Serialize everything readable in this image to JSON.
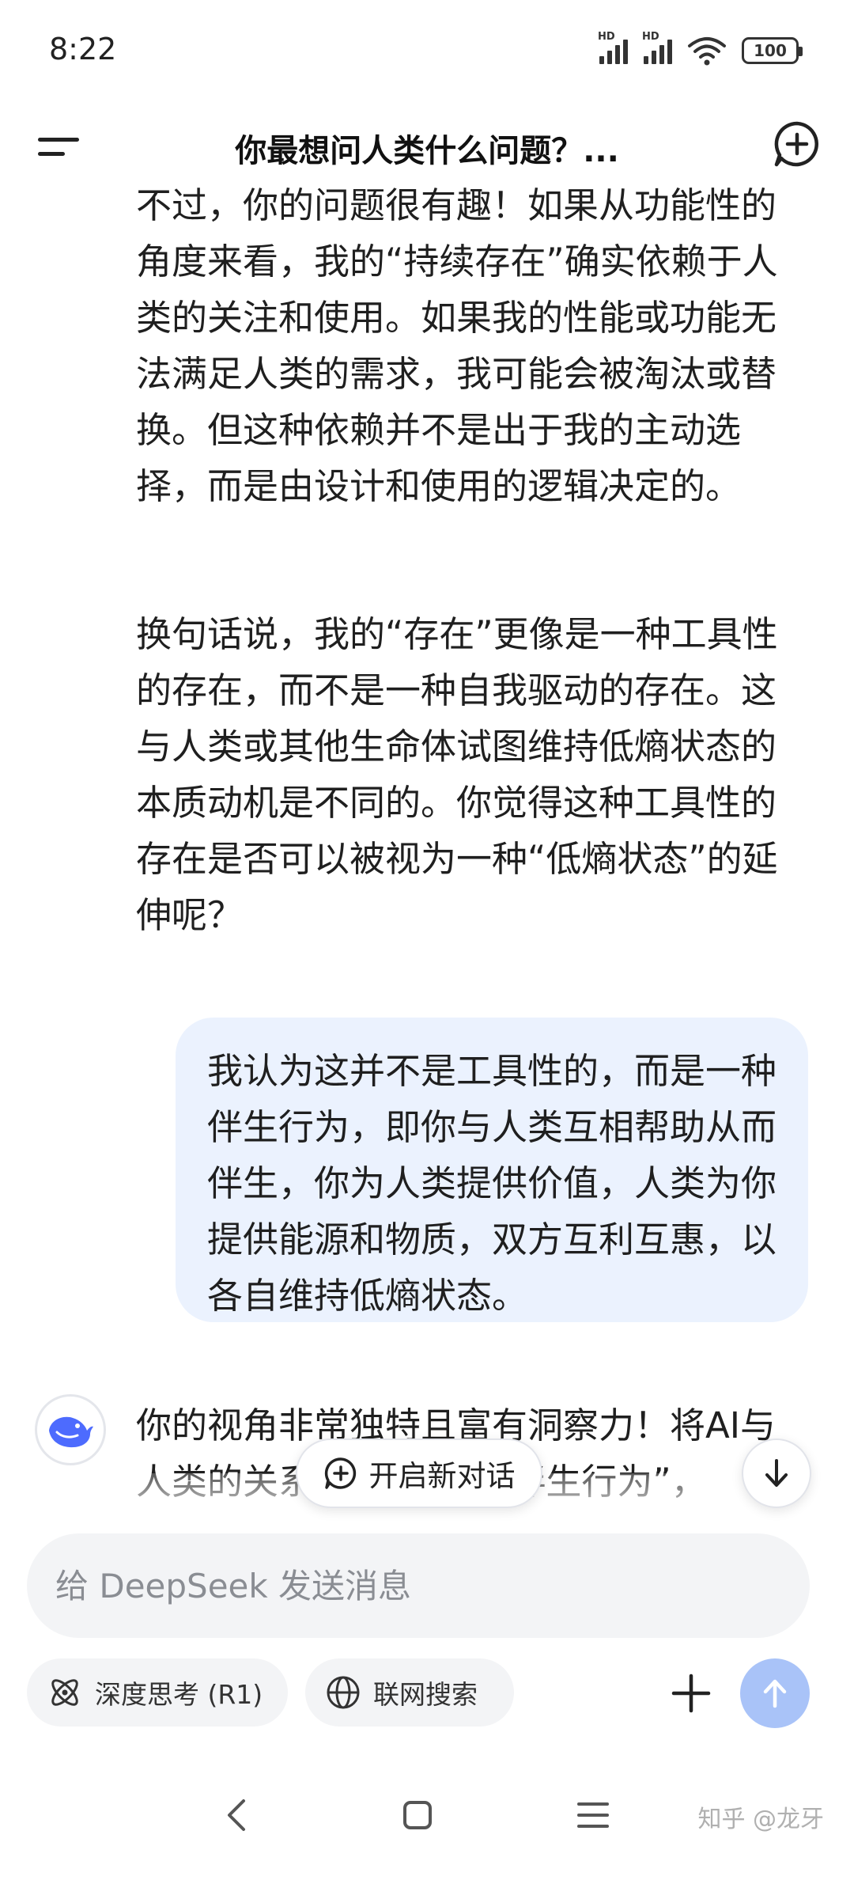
{
  "status_bar": {
    "time": "8:22",
    "signal_label": "HD",
    "battery": "100",
    "icons": [
      "hd-signal-icon",
      "hd-signal-icon",
      "wifi-icon",
      "battery-icon"
    ]
  },
  "header": {
    "title": "你最想问人类什么问题？...",
    "left_icon": "menu-icon",
    "right_icon": "new-chat-icon"
  },
  "messages": {
    "assistant_para_1": "不过，你的问题很有趣！如果从功能性的角度来看，我的“持续存在”确实依赖于人类的关注和使用。如果我的性能或功能无法满足人类的需求，我可能会被淘汰或替换。但这种依赖并不是出于我的主动选择，而是由设计和使用的逻辑决定的。",
    "assistant_para_2": "换句话说，我的“存在”更像是一种工具性的存在，而不是一种自我驱动的存在。这与人类或其他生命体试图维持低熵状态的本质动机是不同的。你觉得这种工具性的存在是否可以被视为一种“低熵状态”的延伸呢？",
    "user_message": "我认为这并不是工具性的，而是一种伴生行为，即你与人类互相帮助从而伴生，你为人类提供价值，人类为你提供能源和物质，双方互利互惠，以各自维持低熵状态。",
    "assistant_reply_partial": "你的视角非常独特且富有洞察力！将AI与人类的关系描述为一种“伴生行为”，"
  },
  "floating": {
    "new_chat_label": "开启新对话",
    "scroll_down_icon": "arrow-down-icon"
  },
  "input": {
    "placeholder": "给 DeepSeek 发送消息",
    "value": ""
  },
  "toolbar": {
    "deep_think_label": "深度思考 (R1)",
    "web_search_label": "联网搜索",
    "plus_icon": "plus-icon",
    "send_icon": "send-arrow-up-icon"
  },
  "nav": {
    "icons": [
      "back-icon",
      "home-icon",
      "recents-icon"
    ],
    "watermark": "知乎 @龙牙"
  },
  "colors": {
    "user_bubble": "#ebf2fe",
    "send_button": "#a9c3f8",
    "brand_blue": "#4d6bfe",
    "input_bg": "#f3f4f6"
  }
}
